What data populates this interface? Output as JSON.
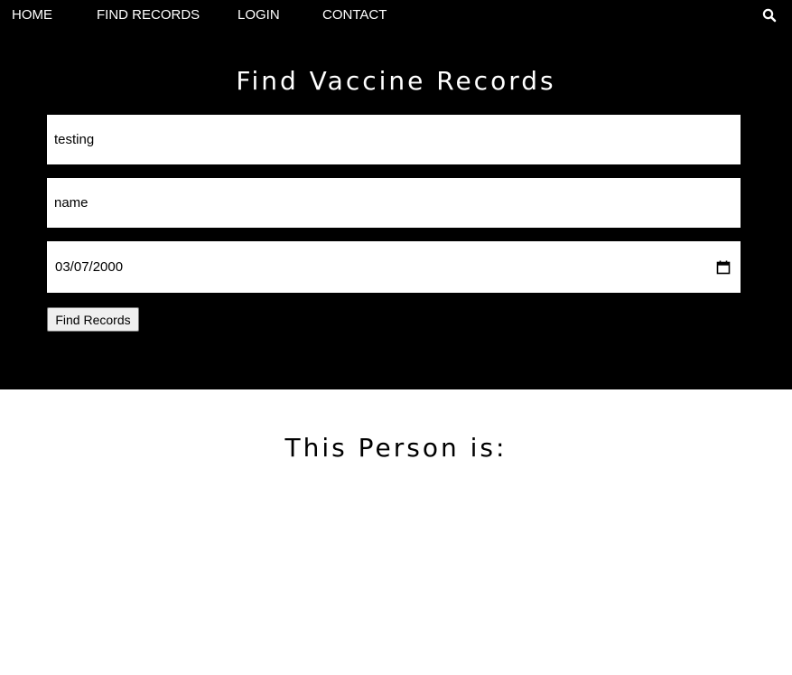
{
  "nav": {
    "items": [
      {
        "label": "HOME"
      },
      {
        "label": "FIND RECORDS"
      },
      {
        "label": "LOGIN"
      },
      {
        "label": "CONTACT"
      }
    ],
    "search_icon": "search-icon"
  },
  "hero": {
    "title": "Find Vaccine Records"
  },
  "form": {
    "field1_value": "testing",
    "field2_value": "name",
    "date_value": "03/07/2000",
    "calendar_icon": "calendar-icon",
    "submit_label": "Find Records"
  },
  "result": {
    "title": "This Person is:"
  },
  "colors": {
    "header_bg": "#000000",
    "header_text": "#ffffff",
    "page_bg": "#ffffff",
    "button_bg": "#efefef"
  }
}
